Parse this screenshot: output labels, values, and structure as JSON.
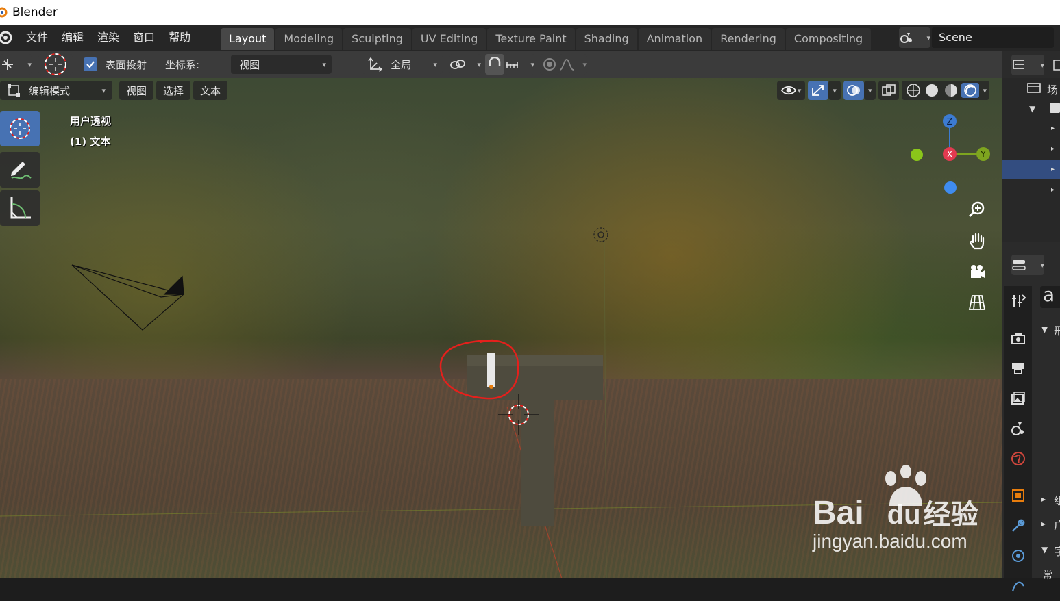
{
  "window": {
    "title": "Blender"
  },
  "menu": {
    "items": [
      "文件",
      "编辑",
      "渲染",
      "窗口",
      "帮助"
    ]
  },
  "workspaces": {
    "tabs": [
      "Layout",
      "Modeling",
      "Sculpting",
      "UV Editing",
      "Texture Paint",
      "Shading",
      "Animation",
      "Rendering",
      "Compositing"
    ],
    "active": "Layout"
  },
  "scene": {
    "name": "Scene"
  },
  "tool_header": {
    "surface_project_label": "表面投射",
    "surface_project_checked": true,
    "coord_label": "坐标系:",
    "coord_value": "视图",
    "pivot_value": "全局"
  },
  "viewport_header": {
    "mode": "编辑模式",
    "view": "视图",
    "select": "选择",
    "text": "文本"
  },
  "viewport_info": {
    "perspective": "用户透视",
    "object": "(1) 文本"
  },
  "gizmo": {
    "z": "Z",
    "x": "X",
    "y": "Y"
  },
  "outliner": {
    "fragment": "场"
  },
  "properties": {
    "fragment_a": "a",
    "fragment_1": "刑",
    "fragment_2": "组",
    "fragment_3": "广",
    "fragment_4": "字",
    "fragment_5": "常"
  },
  "watermark": {
    "brand": "Bai",
    "brand_du": "du",
    "brand_cn": "经验",
    "url": "jingyan.baidu.com"
  },
  "colors": {
    "accent": "#4772b3",
    "annotation_red": "#e5201c",
    "gizmo_x": "#e23a50",
    "gizmo_y": "#7ea51f",
    "gizmo_z": "#3c7bd1"
  }
}
